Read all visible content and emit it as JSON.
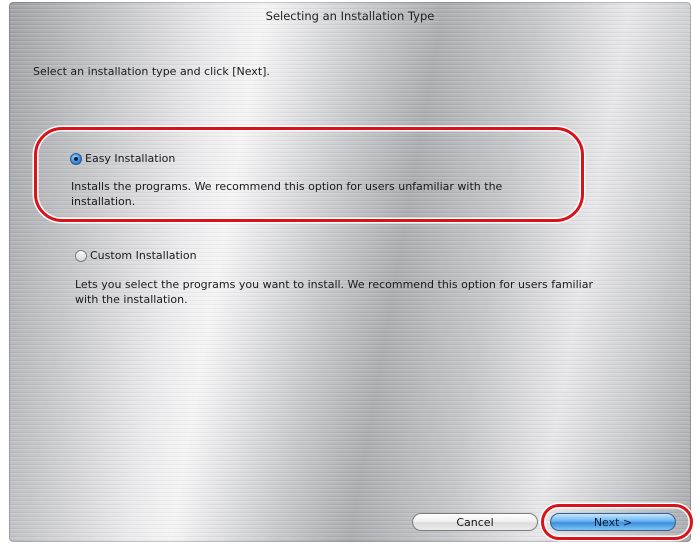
{
  "window": {
    "title": "Selecting an Installation Type"
  },
  "instruction": "Select an installation type and click [Next].",
  "options": [
    {
      "label": "Easy Installation",
      "selected": true,
      "description": "Installs the programs. We recommend this option for users unfamiliar with the installation."
    },
    {
      "label": "Custom Installation",
      "selected": false,
      "description": "Lets you select the programs you want to install. We recommend this option for users familiar with the installation."
    }
  ],
  "buttons": {
    "cancel_label": "Cancel",
    "next_label": "Next >"
  },
  "colors": {
    "highlight": "#d8131a",
    "default_button": "#3b8fdc"
  }
}
